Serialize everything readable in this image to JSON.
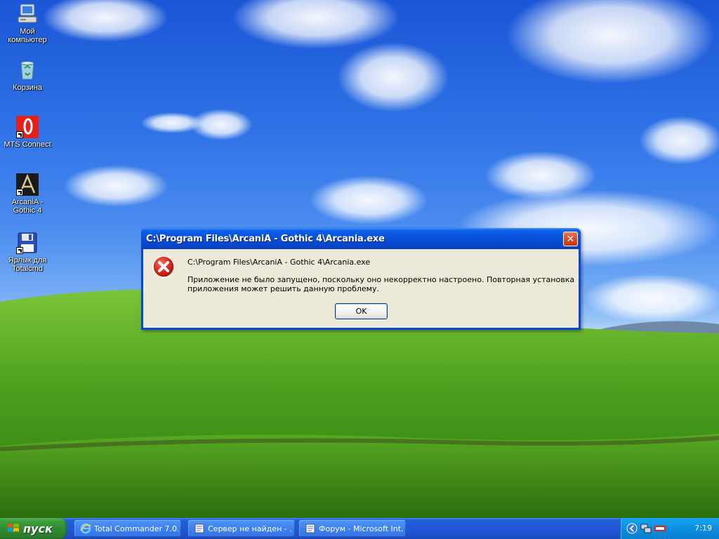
{
  "desktop": {
    "icons": [
      {
        "label": "Мой\nкомпьютер",
        "icon": "my-computer-icon"
      },
      {
        "label": "Корзина",
        "icon": "recycle-bin-icon"
      },
      {
        "label": "MTS Connect",
        "icon": "mts-connect-icon"
      },
      {
        "label": "ArcaniA -\nGothic 4",
        "icon": "arcania-icon"
      },
      {
        "label": "Ярлык для\nTotalcmd",
        "icon": "floppy-disk-icon"
      }
    ]
  },
  "dialog": {
    "title": "C:\\Program Files\\ArcaniA - Gothic 4\\Arcania.exe",
    "close_glyph": "✕",
    "path": "C:\\Program Files\\ArcaniA - Gothic 4\\Arcania.exe",
    "message": "Приложение не было запущено, поскольку оно некорректно настроено. Повторная установка приложения может решить данную проблему.",
    "ok_label": "OK",
    "error_icon": "error-icon"
  },
  "taskbar": {
    "start_label": "пуск",
    "tasks": [
      {
        "label": "Total Commander 7.0...",
        "icon": "internet-explorer-icon"
      },
      {
        "label": "Сервер не найден - ...",
        "icon": "document-icon"
      },
      {
        "label": "Форум - Microsoft Int...",
        "icon": "document-icon"
      }
    ],
    "language": "RU",
    "clock": "7:19"
  },
  "colors": {
    "titlebar": "#0a4fd8",
    "dialog_body": "#ece9d8",
    "start_button": "#2f8b2f",
    "taskbar": "#245edb",
    "tray": "#0d8ee0",
    "close_button": "#d8492a"
  }
}
